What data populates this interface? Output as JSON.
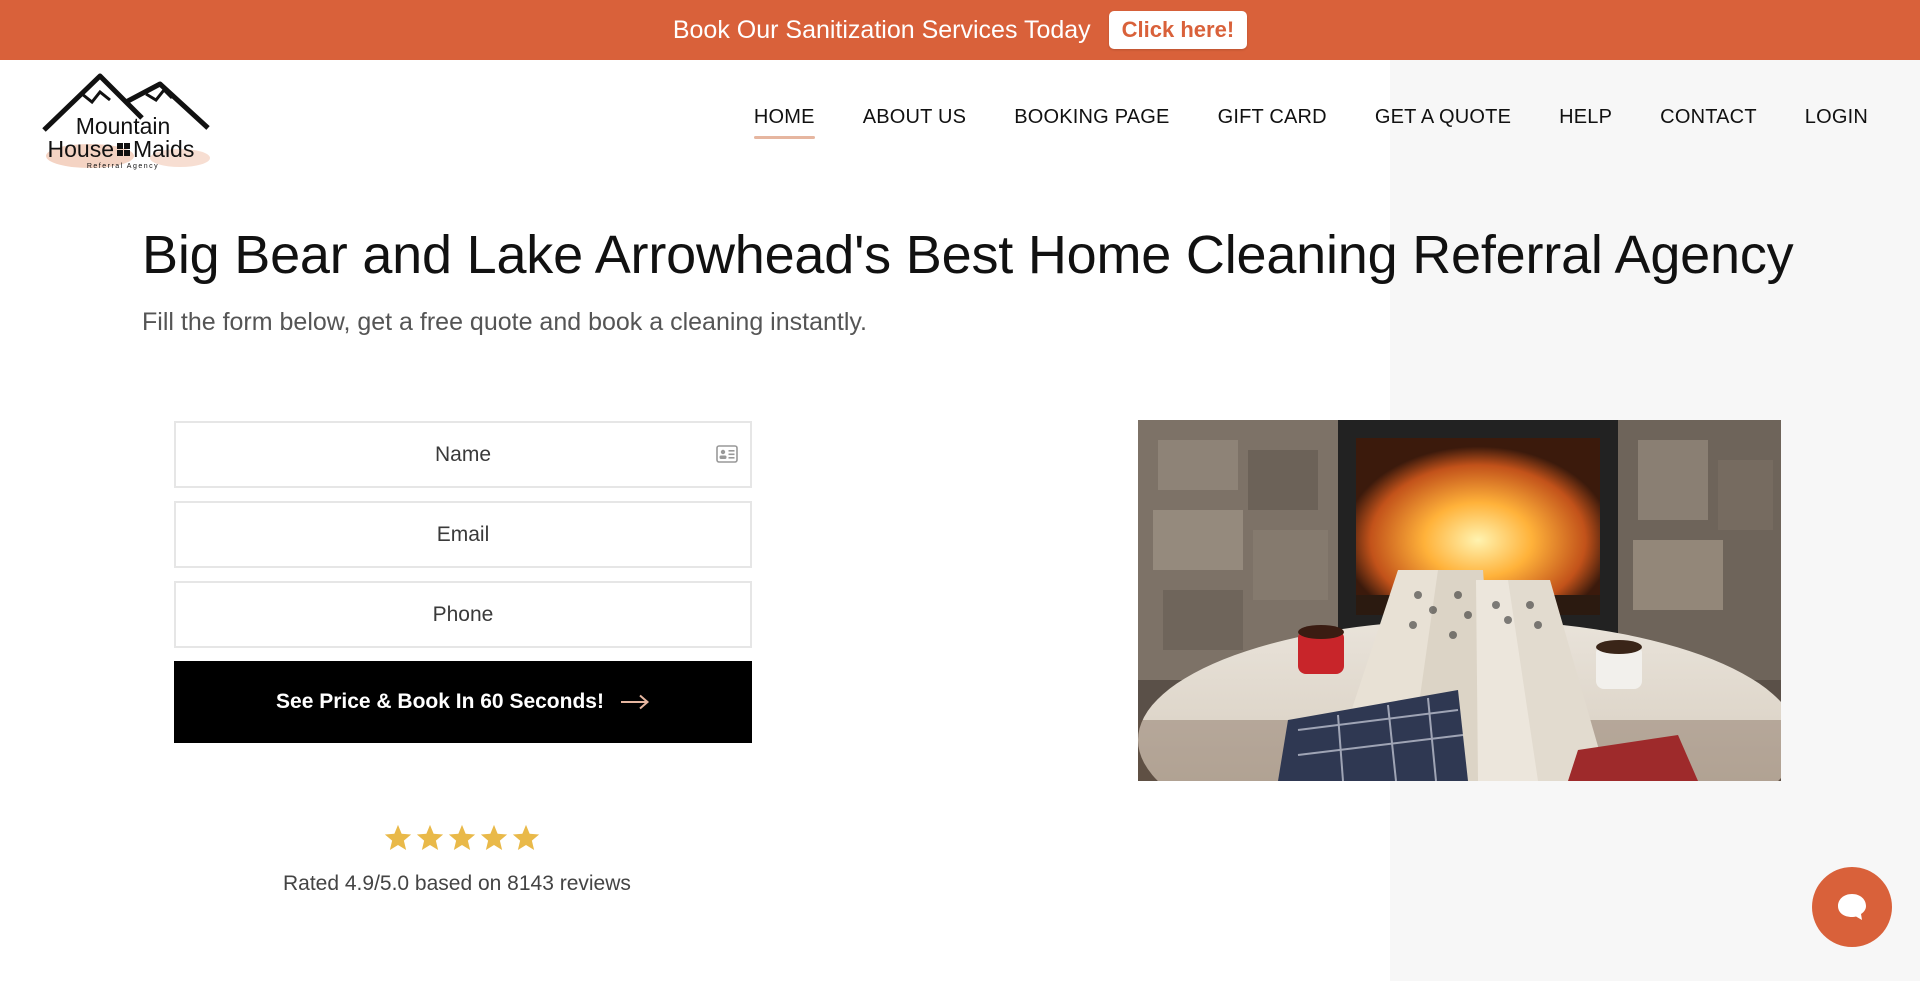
{
  "promo": {
    "text": "Book Our Sanitization Services Today",
    "button_label": "Click here!"
  },
  "logo": {
    "line1": "Mountain",
    "line2a": "House",
    "line2b": "Maids",
    "tagline": "Referral Agency"
  },
  "nav": {
    "items": [
      {
        "label": "HOME",
        "active": true
      },
      {
        "label": "ABOUT US"
      },
      {
        "label": "BOOKING PAGE"
      },
      {
        "label": "GIFT CARD"
      },
      {
        "label": "GET A QUOTE"
      },
      {
        "label": "HELP"
      },
      {
        "label": "CONTACT"
      },
      {
        "label": "LOGIN"
      }
    ]
  },
  "hero": {
    "title": "Big Bear and Lake Arrowhead's Best Home Cleaning Referral Agency",
    "subtitle": "Fill the form below, get a free quote and book a cleaning instantly."
  },
  "form": {
    "name_placeholder": "Name",
    "email_placeholder": "Email",
    "phone_placeholder": "Phone",
    "submit_label": "See Price & Book In 60 Seconds!"
  },
  "rating": {
    "stars": 5,
    "text": "Rated 4.9/5.0 based on 8143 reviews"
  },
  "colors": {
    "brand": "#d9613a",
    "star": "#e9b949",
    "button": "#000000"
  },
  "icons": {
    "name_field": "contact-card-icon",
    "submit": "arrow-right-icon",
    "chat": "chat-bubble-icon"
  }
}
